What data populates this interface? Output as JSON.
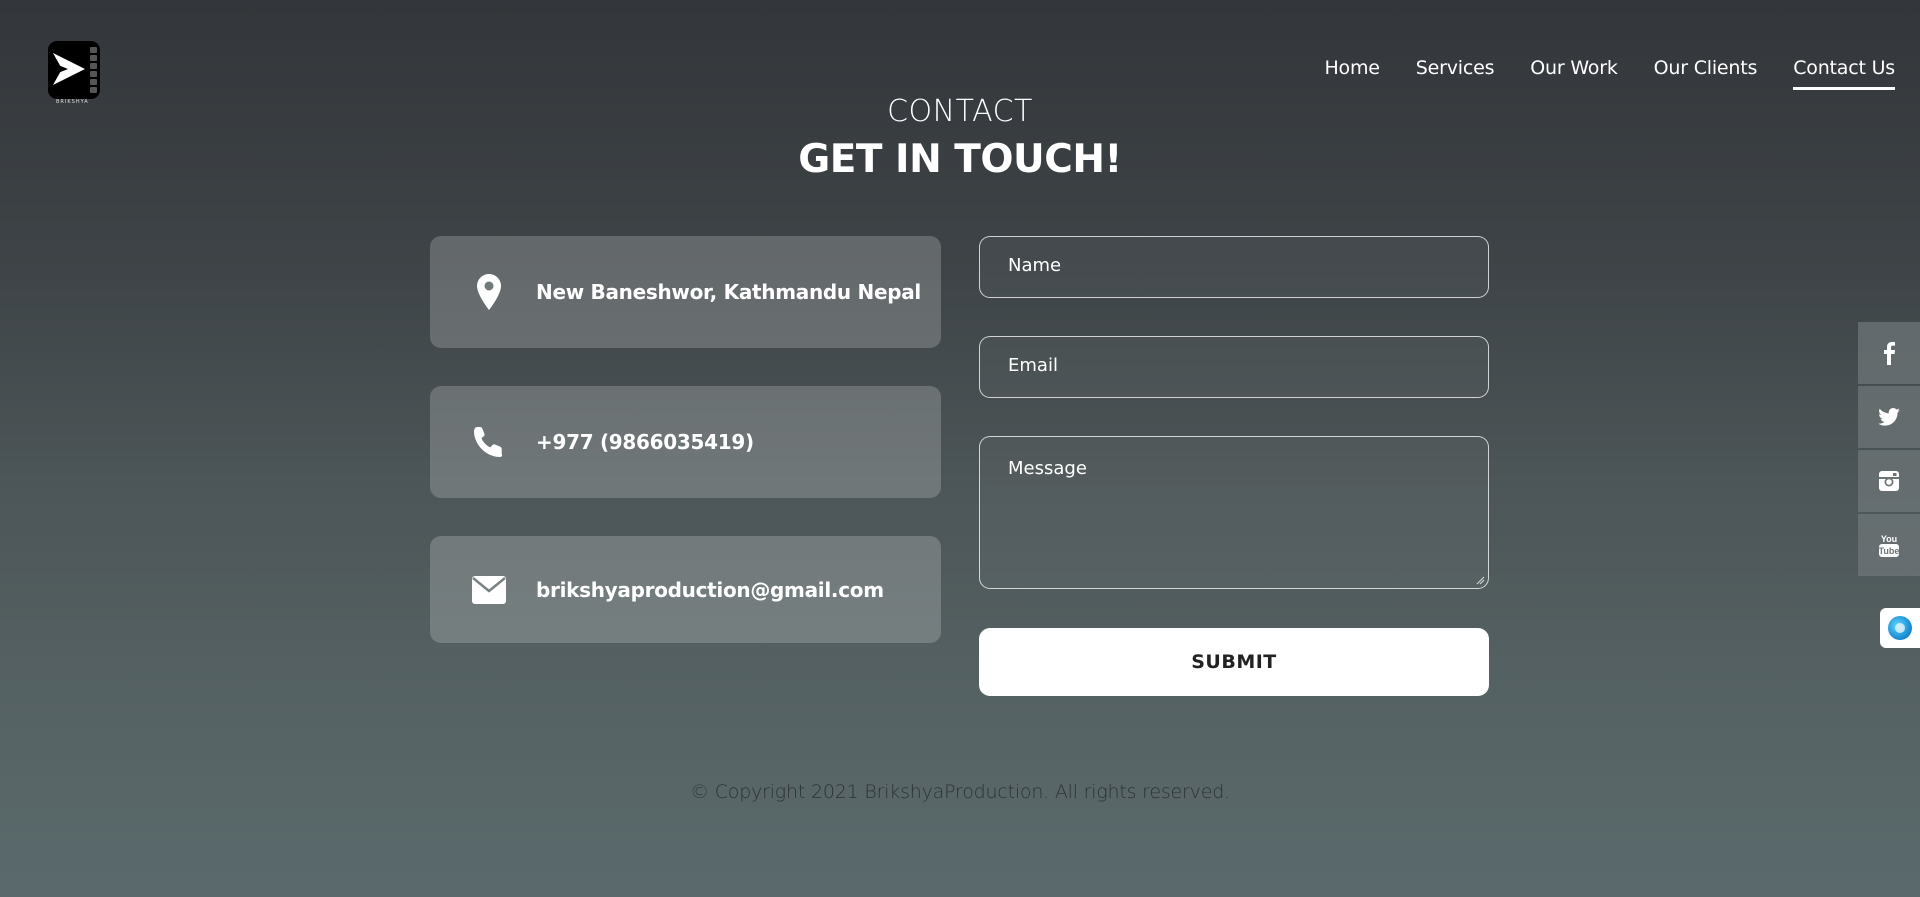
{
  "header": {
    "logo_icon": "play-arrow-film-logo",
    "logo_text": "BRIKSHYA",
    "nav": [
      {
        "label": "Home",
        "active": false
      },
      {
        "label": "Services",
        "active": false
      },
      {
        "label": "Our Work",
        "active": false
      },
      {
        "label": "Our Clients",
        "active": false
      },
      {
        "label": "Contact Us",
        "active": true
      }
    ]
  },
  "section": {
    "eyebrow": "CONTACT",
    "title": "GET IN TOUCH!"
  },
  "contact_info": [
    {
      "icon": "location-pin-icon",
      "text": "New Baneshwor, Kathmandu Nepal"
    },
    {
      "icon": "phone-icon",
      "text": "+977 (9866035419)"
    },
    {
      "icon": "envelope-icon",
      "text": "brikshyaproduction@gmail.com"
    }
  ],
  "form": {
    "name_placeholder": "Name",
    "email_placeholder": "Email",
    "message_placeholder": "Message",
    "submit_label": "SUBMIT"
  },
  "social": [
    {
      "icon": "facebook-icon"
    },
    {
      "icon": "twitter-icon"
    },
    {
      "icon": "instagram-icon"
    },
    {
      "icon": "youtube-icon"
    }
  ],
  "chat_widget_icon": "chat-widget-icon",
  "footer": {
    "copyright": "© Copyright 2021 BrikshyaProduction. All rights reserved."
  },
  "colors": {
    "background_top": "#33363a",
    "background_bottom": "#5a6a6c",
    "card_background": "rgba(255,255,255,0.2)",
    "submit_background": "#ffffff",
    "submit_text": "#222222"
  }
}
